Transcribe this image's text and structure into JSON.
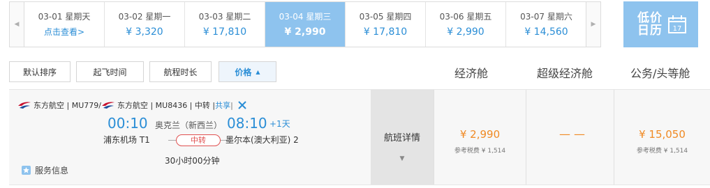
{
  "date_strip": {
    "dates": [
      {
        "date": "03-01 星期天",
        "price": "点击查看>"
      },
      {
        "date": "03-02 星期一",
        "price": "¥ 3,320"
      },
      {
        "date": "03-03 星期二",
        "price": "¥ 17,810"
      },
      {
        "date": "03-04 星期三",
        "price": "¥ 2,990"
      },
      {
        "date": "03-05 星期四",
        "price": "¥ 17,810"
      },
      {
        "date": "03-06 星期五",
        "price": "¥ 2,990"
      },
      {
        "date": "03-07 星期六",
        "price": "¥ 14,560"
      }
    ],
    "selected_index": 3
  },
  "calendar": {
    "line1": "低价",
    "line2": "日历",
    "day": "17"
  },
  "sort": {
    "default": "默认排序",
    "departure": "起飞时间",
    "duration": "航程时长",
    "price": "价格"
  },
  "columns": {
    "economy": "经济舱",
    "premium": "超级经济舱",
    "business": "公务/头等舱"
  },
  "flight": {
    "seg1": "东方航空 | MU779/",
    "seg2": "东方航空 | MU8436 | 中转 | ",
    "share": "共享",
    "sep": " |",
    "dep_time": "00:10",
    "dep_city": "奥克兰（新西兰）",
    "arr_time": "08:10",
    "plus_day": "+1天",
    "dep_airport": "浦东机场 T1",
    "transit": "中转",
    "arr_airport": "墨尔本(澳大利亚) 2",
    "duration": "30小时00分钟",
    "service": "服务信息",
    "details": "航班详情",
    "economy_price": "¥ 2,990",
    "economy_tax": "参考税费 ¥ 1,514",
    "premium_price": "— —",
    "business_price": "¥ 15,050",
    "business_tax": "参考税费 ¥ 1,514"
  },
  "colors": {
    "accent": "#2b8ed6",
    "selected": "#8ec3ee",
    "price": "#f08a24",
    "transit": "#e05050"
  },
  "icons": {
    "left": "chevron-left-icon",
    "right": "chevron-right-icon",
    "calendar": "calendar-icon",
    "airline": "china-eastern-logo-icon",
    "meal": "cutlery-icon",
    "service": "star-badge-icon",
    "expand": "caret-down-icon"
  }
}
